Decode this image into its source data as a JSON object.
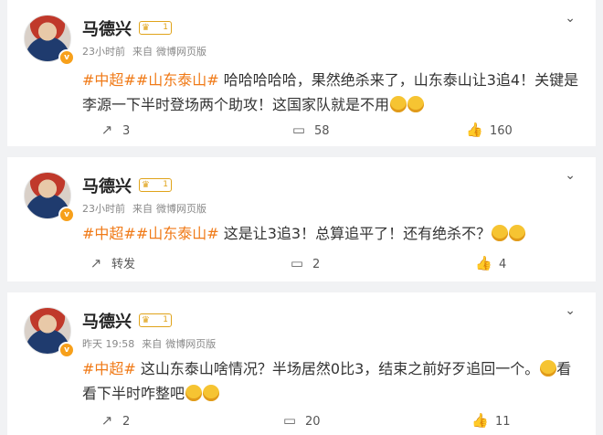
{
  "posts": [
    {
      "author": "马德兴",
      "level": "1",
      "time": "23小时前",
      "source_prefix": "来自",
      "source": "微博网页版",
      "tag1": "#中超#",
      "tag2": "#山东泰山#",
      "text": " 哈哈哈哈哈，果然绝杀来了，山东泰山让3追4！关键是李源一下半时登场两个助攻！这国家队就是不用",
      "emoji_count": 2,
      "repost": "3",
      "comments": "58",
      "likes": "160"
    },
    {
      "author": "马德兴",
      "level": "1",
      "time": "23小时前",
      "source_prefix": "来自",
      "source": "微博网页版",
      "tag1": "#中超#",
      "tag2": "#山东泰山#",
      "text": " 这是让3追3！总算追平了！还有绝杀不？",
      "emoji_count": 2,
      "repost": "转发",
      "comments": "2",
      "likes": "4"
    },
    {
      "author": "马德兴",
      "level": "1",
      "time": "昨天 19:58",
      "source_prefix": "来自",
      "source": "微博网页版",
      "tag1": "#中超#",
      "tag2": "",
      "text": " 这山东泰山啥情况？半场居然0比3，结束之前好歹追回一个。",
      "text_after_emoji": "看看下半时咋整吧",
      "emoji_count": 2,
      "repost": "2",
      "comments": "20",
      "likes": "11"
    }
  ],
  "icons": {
    "repost": "repost-icon",
    "comment": "comment-icon",
    "like": "like-icon",
    "more": "chevron-down-icon"
  },
  "colors": {
    "tag": "#f07a17",
    "background": "#f1f2f4",
    "vip": "#f7a01b"
  }
}
